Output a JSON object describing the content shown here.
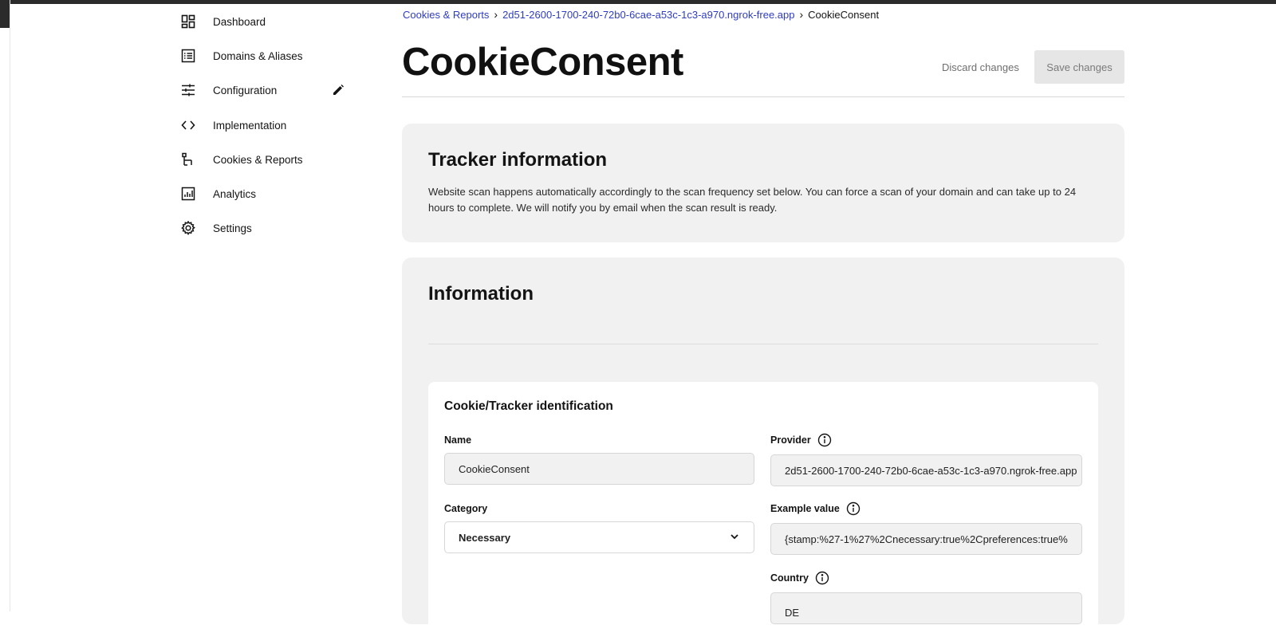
{
  "sidebar": {
    "items": [
      {
        "label": "Dashboard",
        "icon": "dashboard-icon"
      },
      {
        "label": "Domains & Aliases",
        "icon": "list-icon"
      },
      {
        "label": "Configuration",
        "icon": "sliders-icon",
        "edit_icon": "pencil-icon"
      },
      {
        "label": "Implementation",
        "icon": "code-icon"
      },
      {
        "label": "Cookies & Reports",
        "icon": "tree-icon"
      },
      {
        "label": "Analytics",
        "icon": "chart-icon"
      },
      {
        "label": "Settings",
        "icon": "gear-icon"
      }
    ]
  },
  "breadcrumb": {
    "items": [
      "Cookies & Reports",
      "2d51-2600-1700-240-72b0-6cae-a53c-1c3-a970.ngrok-free.app"
    ],
    "separator": "›",
    "current": "CookieConsent"
  },
  "page": {
    "title": "CookieConsent",
    "discard_label": "Discard changes",
    "save_label": "Save changes"
  },
  "tracker_info": {
    "heading": "Tracker information",
    "text": "Website scan happens automatically accordingly to the scan frequency set below. You can force a scan of your domain and can take up to 24 hours to complete. We will notify you by email when the scan result is ready."
  },
  "information": {
    "heading": "Information",
    "identification": {
      "heading": "Cookie/Tracker identification",
      "name_label": "Name",
      "name_value": "CookieConsent",
      "category_label": "Category",
      "category_value": "Necessary",
      "provider_label": "Provider",
      "provider_value": "2d51-2600-1700-240-72b0-6cae-a53c-1c3-a970.ngrok-free.app",
      "example_label": "Example value",
      "example_value": "{stamp:%27-1%27%2Cnecessary:true%2Cpreferences:true%",
      "country_label": "Country",
      "country_value": "DE"
    }
  },
  "colors": {
    "link": "#2f3cc4",
    "card_bg": "#f1f1f1",
    "save_bg": "#e6e6e6"
  }
}
